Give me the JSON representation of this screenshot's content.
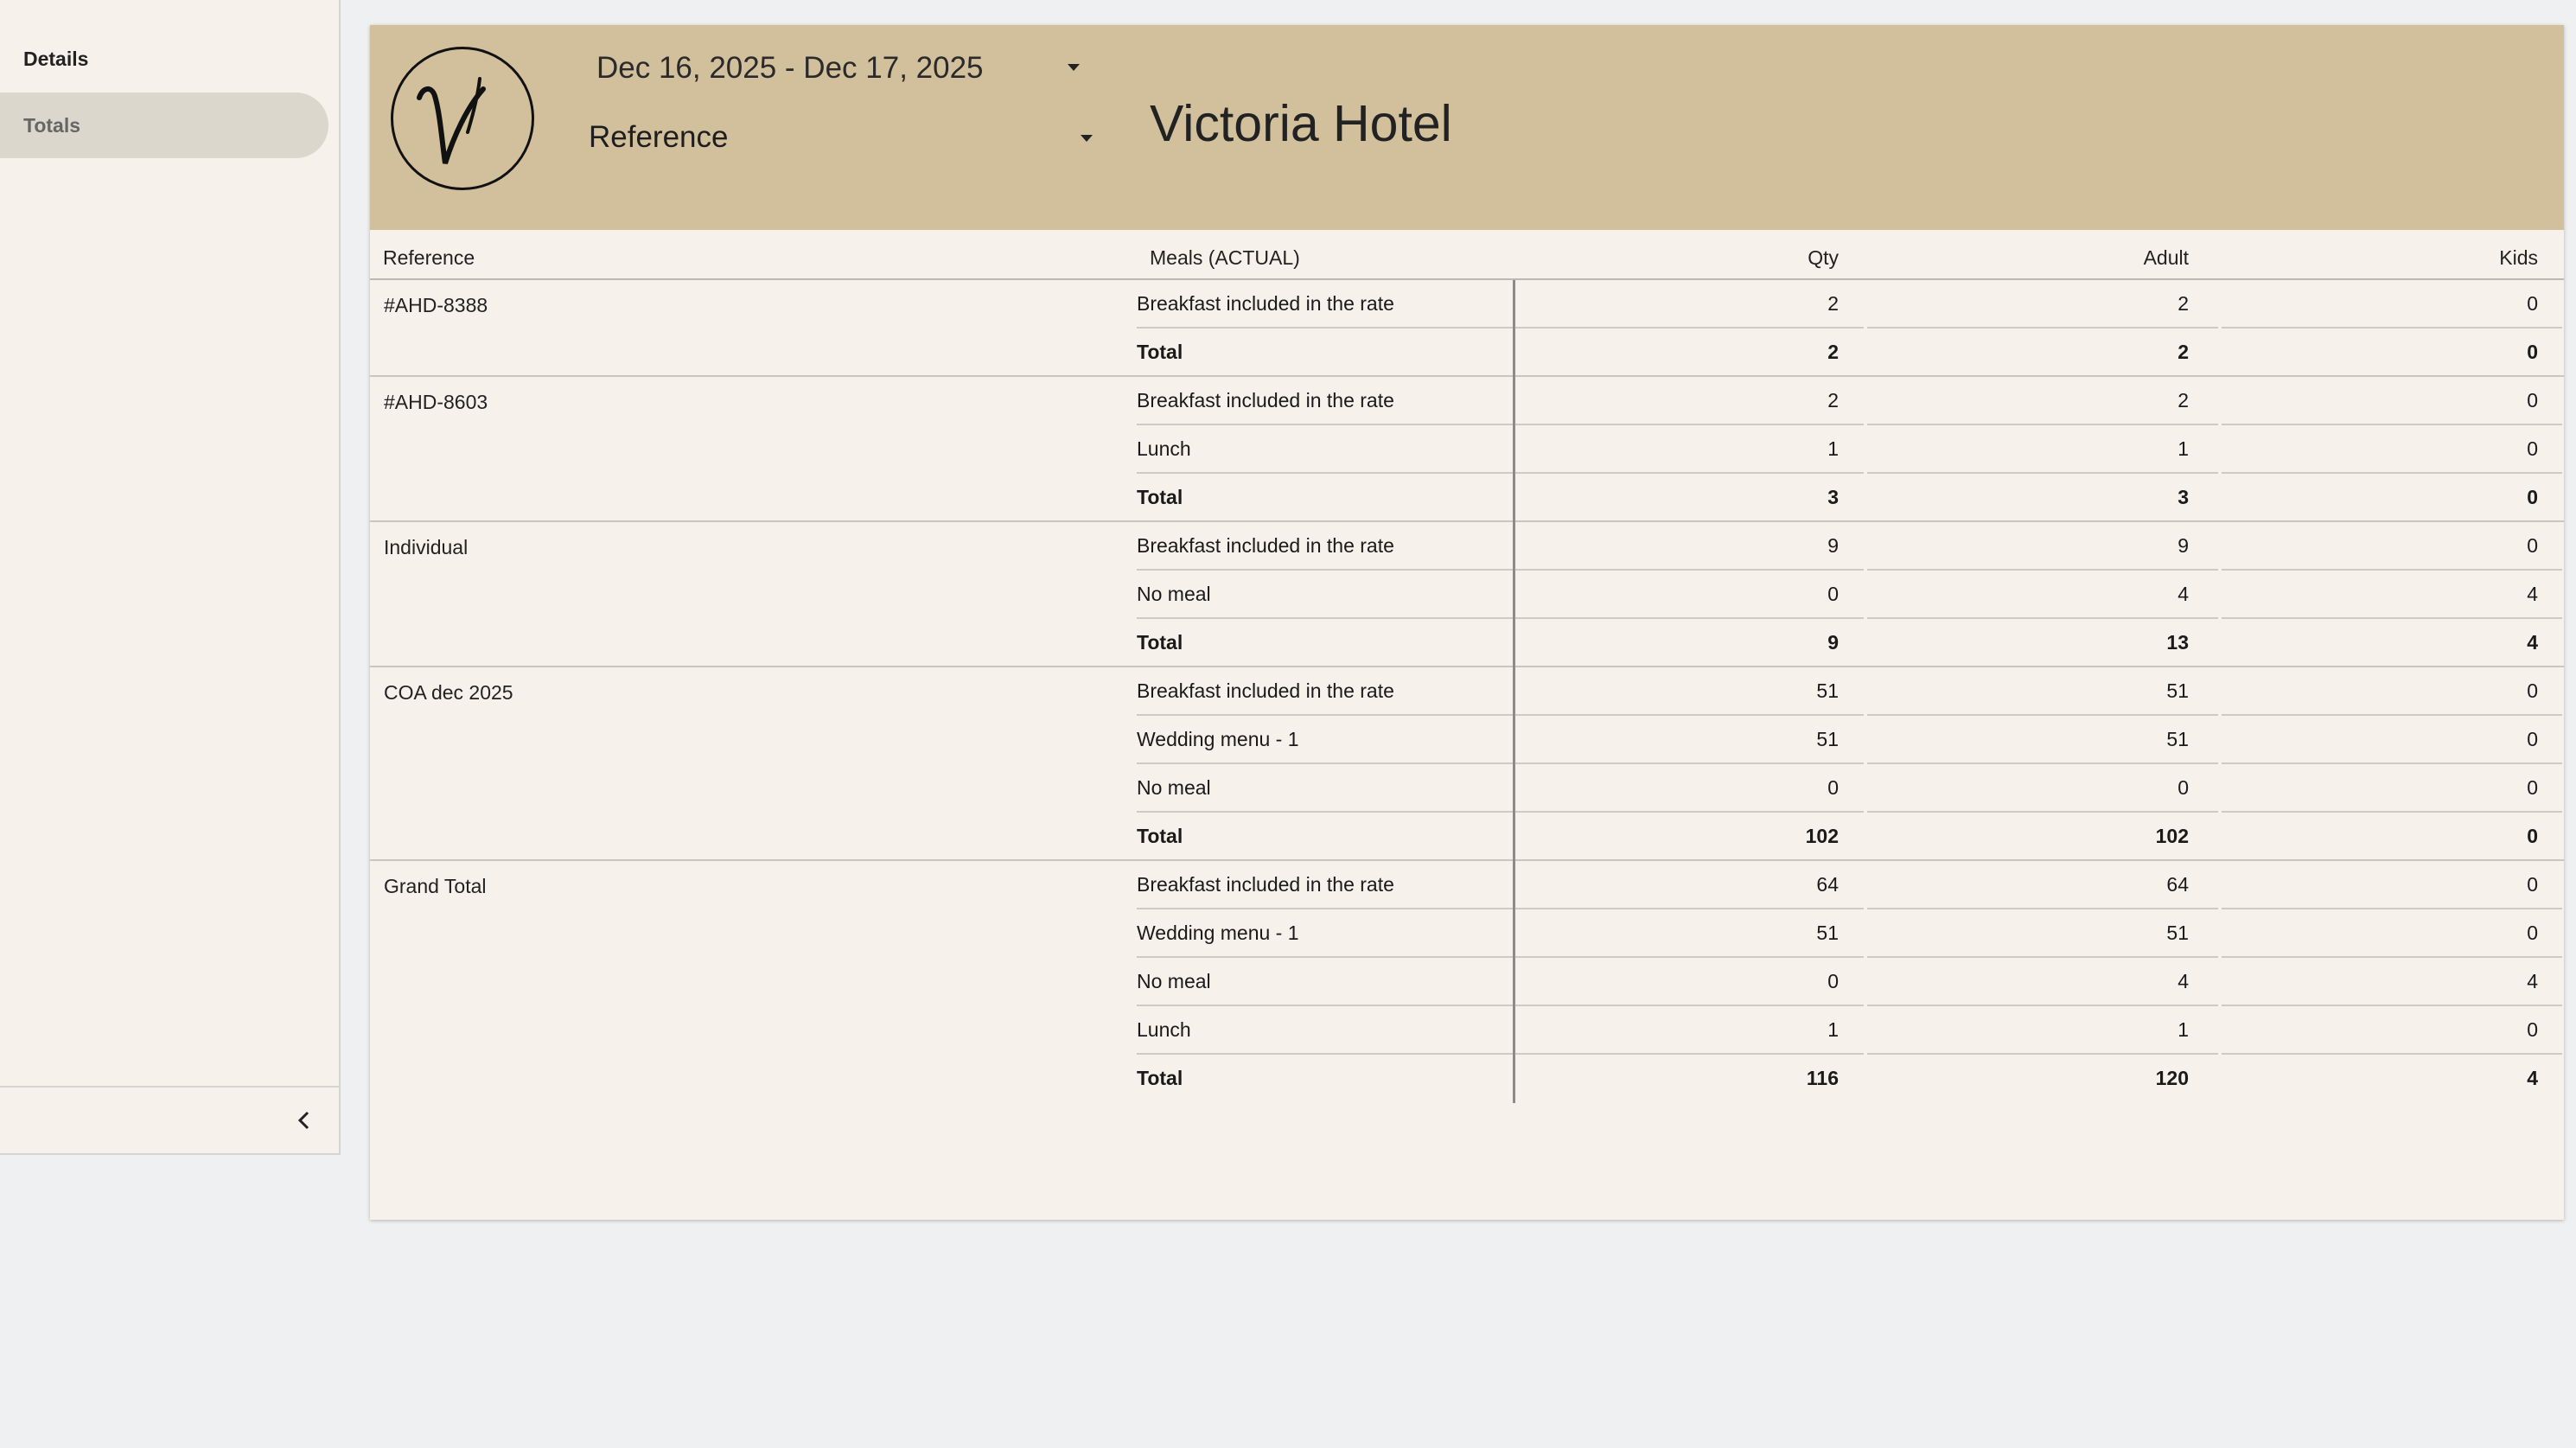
{
  "sidebar": {
    "items": [
      {
        "label": "Details"
      },
      {
        "label": "Totals"
      }
    ]
  },
  "header": {
    "date_range": "Dec 16, 2025 - Dec 17, 2025",
    "group_by": "Reference",
    "hotel_name": "Victoria Hotel"
  },
  "table": {
    "columns": [
      "Reference",
      "Meals (ACTUAL)",
      "Qty",
      "Adult",
      "Kids"
    ],
    "groups": [
      {
        "reference": "#AHD-8388",
        "rows": [
          {
            "meal": "Breakfast included in the rate",
            "qty": "2",
            "adult": "2",
            "kids": "0"
          },
          {
            "meal": "Total",
            "qty": "2",
            "adult": "2",
            "kids": "0",
            "total": true
          }
        ]
      },
      {
        "reference": "#AHD-8603",
        "rows": [
          {
            "meal": "Breakfast included in the rate",
            "qty": "2",
            "adult": "2",
            "kids": "0"
          },
          {
            "meal": "Lunch",
            "qty": "1",
            "adult": "1",
            "kids": "0"
          },
          {
            "meal": "Total",
            "qty": "3",
            "adult": "3",
            "kids": "0",
            "total": true
          }
        ]
      },
      {
        "reference": "Individual",
        "rows": [
          {
            "meal": "Breakfast included in the rate",
            "qty": "9",
            "adult": "9",
            "kids": "0"
          },
          {
            "meal": "No meal",
            "qty": "0",
            "adult": "4",
            "kids": "4"
          },
          {
            "meal": "Total",
            "qty": "9",
            "adult": "13",
            "kids": "4",
            "total": true
          }
        ]
      },
      {
        "reference": "COA dec 2025",
        "rows": [
          {
            "meal": "Breakfast included in the rate",
            "qty": "51",
            "adult": "51",
            "kids": "0"
          },
          {
            "meal": "Wedding menu - 1",
            "qty": "51",
            "adult": "51",
            "kids": "0"
          },
          {
            "meal": "No meal",
            "qty": "0",
            "adult": "0",
            "kids": "0"
          },
          {
            "meal": "Total",
            "qty": "102",
            "adult": "102",
            "kids": "0",
            "total": true
          }
        ]
      },
      {
        "reference": "Grand Total",
        "rows": [
          {
            "meal": "Breakfast included in the rate",
            "qty": "64",
            "adult": "64",
            "kids": "0"
          },
          {
            "meal": "Wedding menu - 1",
            "qty": "51",
            "adult": "51",
            "kids": "0"
          },
          {
            "meal": "No meal",
            "qty": "0",
            "adult": "4",
            "kids": "4"
          },
          {
            "meal": "Lunch",
            "qty": "1",
            "adult": "1",
            "kids": "0"
          },
          {
            "meal": "Total",
            "qty": "116",
            "adult": "120",
            "kids": "4",
            "total": true
          }
        ]
      }
    ]
  },
  "icons": {
    "dropdown": "caret-down-icon",
    "collapse": "chevron-left-icon",
    "logo": "hotel-logo-v"
  }
}
